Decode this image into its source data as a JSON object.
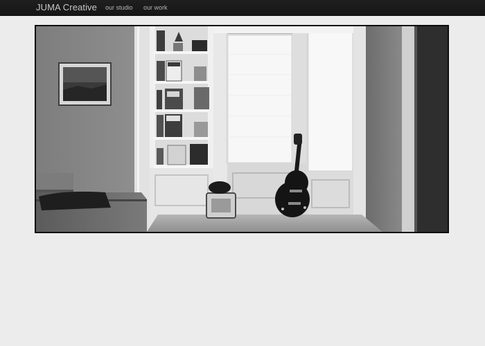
{
  "navbar": {
    "brand": "JUMA Creative",
    "links": [
      {
        "label": "our studio"
      },
      {
        "label": "our work"
      }
    ]
  },
  "hero": {
    "alt": "Black and white photo of a studio room with a bookshelf, bay window, guitar and amplifier",
    "tone": "grayscale"
  }
}
